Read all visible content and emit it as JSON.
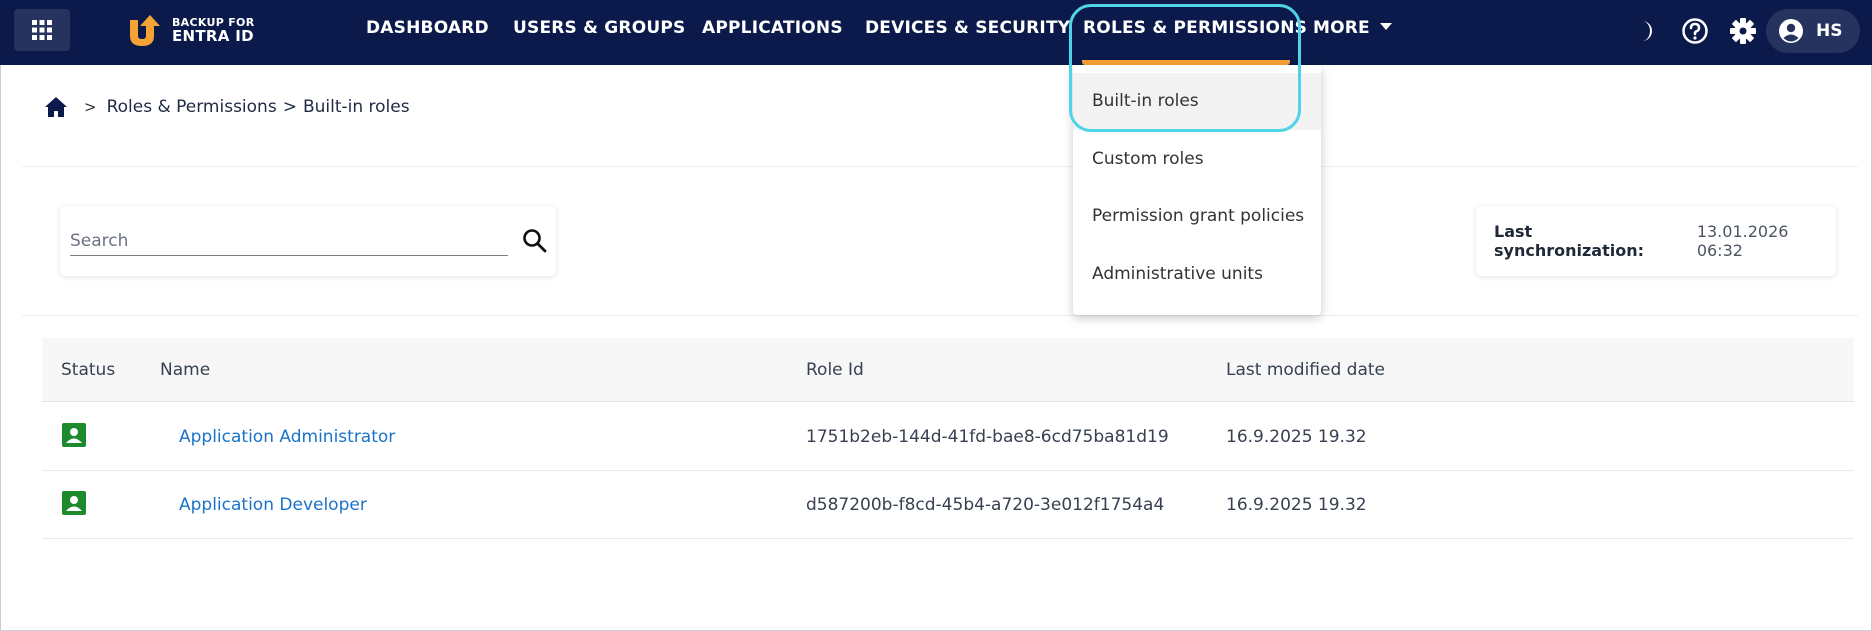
{
  "app": {
    "logo_line1": "BACKUP FOR",
    "logo_line2": "ENTRA ID",
    "logo_color": "#f7a234",
    "topbar_color": "#0b1a4a"
  },
  "nav": {
    "items": [
      {
        "label": "DASHBOARD"
      },
      {
        "label": "USERS & GROUPS"
      },
      {
        "label": "APPLICATIONS"
      },
      {
        "label": "DEVICES & SECURITY"
      },
      {
        "label": "ROLES & PERMISSIONS",
        "active": true
      },
      {
        "label": "MORE"
      }
    ],
    "icons": [
      "apps-grid-icon",
      "dark-mode-moon-icon",
      "help-icon",
      "settings-gear-icon",
      "account-circle-icon"
    ],
    "user_initials": "HS"
  },
  "dropdown": {
    "items": [
      {
        "label": "Built-in roles",
        "active": true
      },
      {
        "label": "Custom roles"
      },
      {
        "label": "Permission grant policies"
      },
      {
        "label": "Administrative units"
      }
    ]
  },
  "breadcrumb": {
    "sep": ">",
    "items": [
      "Roles & Permissions",
      "Built-in roles"
    ]
  },
  "search": {
    "placeholder": "Search",
    "value": ""
  },
  "sync": {
    "label": "Last synchronization:",
    "value": "13.01.2026 06:32"
  },
  "table": {
    "columns": [
      "Status",
      "Name",
      "Role Id",
      "Last modified date"
    ],
    "rows": [
      {
        "name": "Application Administrator",
        "role_id": "1751b2eb-144d-41fd-bae8-6cd75ba81d19",
        "modified": "16.9.2025 19.32",
        "status_color": "#1e8a2e"
      },
      {
        "name": "Application Developer",
        "role_id": "d587200b-f8cd-45b4-a720-3e012f1754a4",
        "modified": "16.9.2025 19.32",
        "status_color": "#1e8a2e"
      }
    ]
  },
  "colors": {
    "accent": "#f7a234",
    "link": "#1a73c8",
    "highlight": "#4fd3e6",
    "status": "#1e8a2e"
  }
}
